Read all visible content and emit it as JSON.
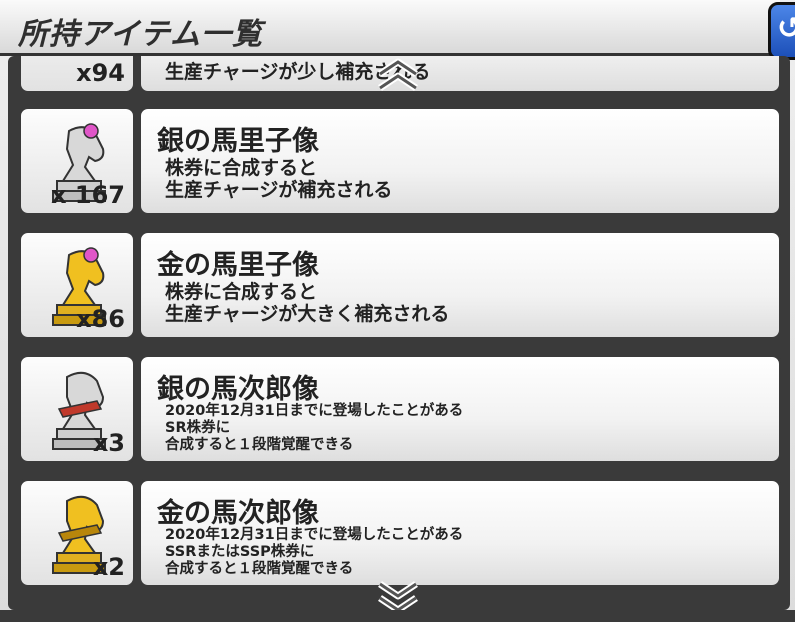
{
  "header": {
    "title": "所持アイテム一覧"
  },
  "items": [
    {
      "name": "",
      "desc": "生産チャージが少し補充される",
      "qty": "x94",
      "metal": "partial"
    },
    {
      "name": "銀の馬里子像",
      "desc": "株券に合成すると\n生産チャージが補充される",
      "qty": "x 167",
      "metal": "silver"
    },
    {
      "name": "金の馬里子像",
      "desc": "株券に合成すると\n生産チャージが大きく補充される",
      "qty": "x86",
      "metal": "gold"
    },
    {
      "name": "銀の馬次郎像",
      "desc": "2020年12月31日までに登場したことがある\nSR株券に\n合成すると１段階覚醒できる",
      "qty": "x3",
      "metal": "silver"
    },
    {
      "name": "金の馬次郎像",
      "desc": "2020年12月31日までに登場したことがある\nSSRまたはSSP株券に\n合成すると１段階覚醒できる",
      "qty": "x2",
      "metal": "gold"
    }
  ],
  "colors": {
    "gold": "#f0c020",
    "silver": "#d8d8d8",
    "accent": "#2a5fd0"
  }
}
